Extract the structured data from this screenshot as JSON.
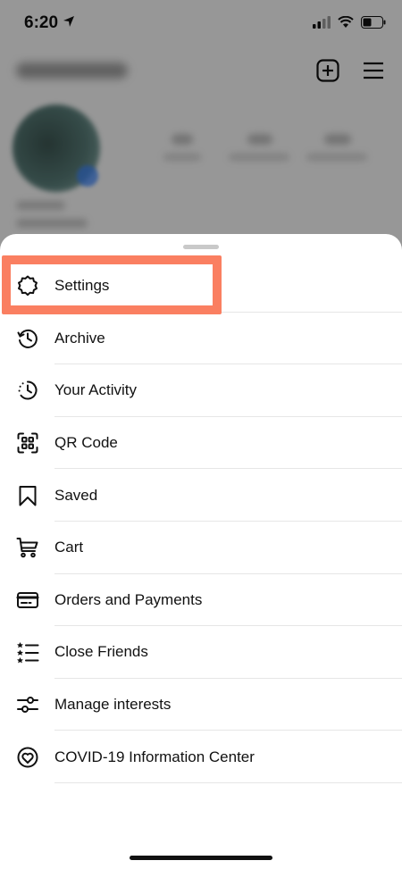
{
  "status_bar": {
    "time": "6:20"
  },
  "menu": {
    "items": [
      {
        "label": "Settings",
        "icon": "settings-gear-icon"
      },
      {
        "label": "Archive",
        "icon": "archive-history-icon"
      },
      {
        "label": "Your Activity",
        "icon": "activity-clock-icon"
      },
      {
        "label": "QR Code",
        "icon": "qr-code-icon"
      },
      {
        "label": "Saved",
        "icon": "bookmark-icon"
      },
      {
        "label": "Cart",
        "icon": "cart-icon"
      },
      {
        "label": "Orders and Payments",
        "icon": "card-icon"
      },
      {
        "label": "Close Friends",
        "icon": "star-list-icon"
      },
      {
        "label": "Manage interests",
        "icon": "sliders-icon"
      },
      {
        "label": "COVID-19 Information Center",
        "icon": "heart-badge-icon"
      }
    ]
  },
  "colors": {
    "highlight": "#fa7f61",
    "text": "#111111",
    "separator": "#e6e6e6"
  }
}
